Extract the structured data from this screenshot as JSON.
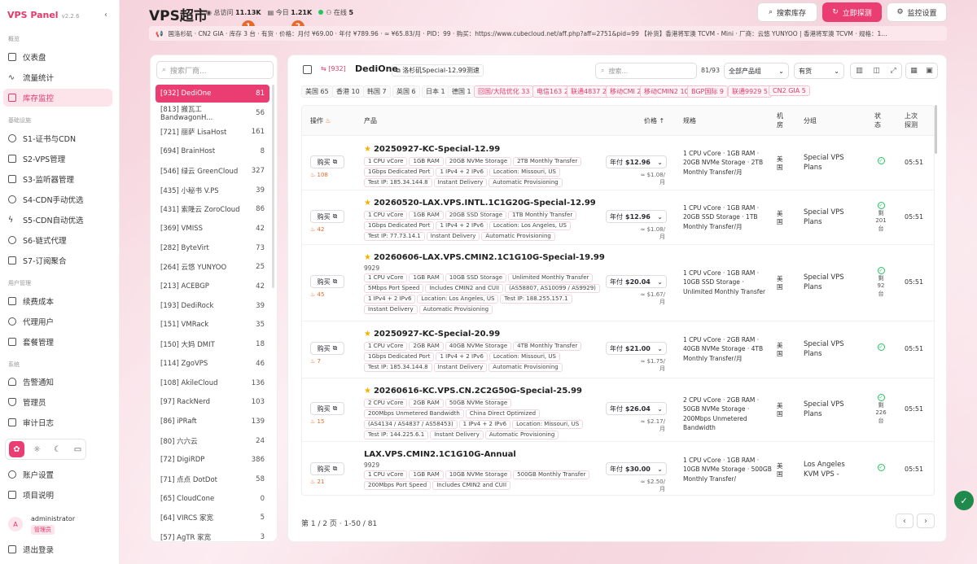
{
  "brand": {
    "name": "VPS Panel",
    "version": "v2.2.6"
  },
  "sidebar": {
    "section_overview": "概览",
    "section_infra": "基础设施",
    "section_user": "用户管理",
    "section_system": "系统",
    "items": [
      "仪表盘",
      "流量统计",
      "库存监控",
      "S1-证书与CDN",
      "S2-VPS管理",
      "S3-监听器管理",
      "S4-CDN手动优选",
      "S5-CDN自动优选",
      "S6-链式代理",
      "S7-订阅聚合",
      "续费成本",
      "代理用户",
      "套餐管理",
      "告警通知",
      "管理员",
      "审计日志",
      "账户设置",
      "项目说明",
      "退出登录"
    ],
    "user": {
      "avatar": "A",
      "name": "administrator",
      "role": "管理员"
    }
  },
  "header": {
    "title": "VPS超市",
    "visits_label": "总访问",
    "visits": "11.13K",
    "today_label": "今日",
    "today": "1.21K",
    "online_label": "在线",
    "online": "5",
    "badge1": "1",
    "badge2": "2",
    "search_btn": "搜索库存",
    "probe_btn": "立即探测",
    "settings_btn": "监控设置",
    "ticker": "国洛杉矶 · CN2 GIA · 库存 3 台 · 有货 · 价格：月付 ¥69.00 · 年付 ¥789.96 · ≈ ¥65.83/月 · PID：99 · 购买：https://www.cubecloud.net/aff.php?aff=2751&pid=99      【补货】香港将军澳 TCVM - Mini · 厂商：云悠 YUNYOO | 香港将军澳 TCVM · 规格：1… "
  },
  "providers": {
    "search_placeholder": "搜索厂商...",
    "items": [
      {
        "label": "[932] DediOne",
        "count": "81"
      },
      {
        "label": "[813] 搬瓦工 BandwagonH...",
        "count": "56"
      },
      {
        "label": "[721] 丽萨 LisaHost",
        "count": "161"
      },
      {
        "label": "[694] BrainHost",
        "count": "8"
      },
      {
        "label": "[546] 绿云 GreenCloud",
        "count": "327"
      },
      {
        "label": "[435] 小秘书 V.PS",
        "count": "39"
      },
      {
        "label": "[431] 索隆云 ZoroCloud",
        "count": "86"
      },
      {
        "label": "[369] VMISS",
        "count": "42"
      },
      {
        "label": "[282] ByteVirt",
        "count": "73"
      },
      {
        "label": "[264] 云悠 YUNYOO",
        "count": "25"
      },
      {
        "label": "[213] ACEBGP",
        "count": "42"
      },
      {
        "label": "[193] DediRock",
        "count": "39"
      },
      {
        "label": "[151] VMRack",
        "count": "35"
      },
      {
        "label": "[150] 大妈 DMIT",
        "count": "18"
      },
      {
        "label": "[114] ZgoVPS",
        "count": "46"
      },
      {
        "label": "[108] AkileCloud",
        "count": "136"
      },
      {
        "label": "[97] RackNerd",
        "count": "103"
      },
      {
        "label": "[86] iPRaft",
        "count": "139"
      },
      {
        "label": "[80] 六六云",
        "count": "24"
      },
      {
        "label": "[72] DigiRDP",
        "count": "386"
      },
      {
        "label": "[71] 点点 DotDot",
        "count": "58"
      },
      {
        "label": "[65] CloudCone",
        "count": "0"
      },
      {
        "label": "[64] VIRCS 家宽",
        "count": "5"
      },
      {
        "label": "[57] AgTR 家宽",
        "count": "3"
      }
    ]
  },
  "main": {
    "provider_tag": "[932]",
    "provider_name": "DediOne",
    "vendor_link": "洛杉矶Special-12.99测速",
    "search_placeholder": "搜索...",
    "count": "81/93",
    "group_select": "全部产品组",
    "stock_select": "有货",
    "chips": [
      {
        "label": "美国",
        "n": "65"
      },
      {
        "label": "香港",
        "n": "10"
      },
      {
        "label": "韩国",
        "n": "7"
      },
      {
        "label": "英国",
        "n": "6"
      },
      {
        "label": "日本",
        "n": "1"
      },
      {
        "label": "德国",
        "n": "1"
      },
      {
        "label": "回国/大陆优化",
        "n": "33"
      },
      {
        "label": "电信163",
        "n": "22"
      },
      {
        "label": "联通4837",
        "n": "22"
      },
      {
        "label": "移动CMI",
        "n": "22"
      },
      {
        "label": "移动CMIN2",
        "n": "10"
      },
      {
        "label": "BGP国际",
        "n": "9"
      },
      {
        "label": "联通9929",
        "n": "5"
      },
      {
        "label": "CN2 GIA",
        "n": "5"
      }
    ],
    "columns": {
      "op": "操作",
      "product": "产品",
      "price": "价格",
      "spec": "规格",
      "dc": "机房",
      "group": "分组",
      "status": "状态",
      "last": "上次探测"
    },
    "buy_label": "购买",
    "rows": [
      {
        "name": "20250927-KC-Special-12.99",
        "star": true,
        "sub": "",
        "tags": [
          "1 CPU vCore",
          "1GB RAM",
          "20GB NVMe Storage",
          "2TB Monthly Transfer",
          "1Gbps Dedicated Port",
          "1 IPv4 + 2 IPv6",
          "Location: Missouri, US",
          "Test IP: 185.34.144.8",
          "Instant Delivery",
          "Automatic Provisioning"
        ],
        "score": "108",
        "price": "$12.96",
        "per": "≈ $1.08/月",
        "spec": "1 CPU vCore · 1GB RAM · 20GB NVMe Storage · 2TB Monthly Transfer/月",
        "dc": "美国",
        "group": "Special VPS Plans",
        "stock": "",
        "time": "05:51"
      },
      {
        "name": "20260520-LAX.VPS.INTL.1C1G20G-Special-12.99",
        "star": true,
        "sub": "",
        "tags": [
          "1 CPU vCore",
          "1GB RAM",
          "20GB SSD Storage",
          "1TB Monthly Transfer",
          "1Gbps Dedicated Port",
          "1 IPv4 + 2 IPv6",
          "Location: Los Angeles, US",
          "Test IP: 77.73.14.1",
          "Instant Delivery",
          "Automatic Provisioning"
        ],
        "score": "42",
        "price": "$12.96",
        "per": "≈ $1.08/月",
        "spec": "1 CPU vCore · 1GB RAM · 20GB SSD Storage · 1TB Monthly Transfer/月",
        "dc": "美国",
        "group": "Special VPS Plans",
        "stock": "剩 201 台",
        "time": "05:51"
      },
      {
        "name": "20260606-LAX.VPS.CMIN2.1C1G10G-Special-19.99",
        "star": true,
        "sub": "9929",
        "tags": [
          "1 CPU vCore",
          "1GB RAM",
          "10GB SSD Storage",
          "Unlimited Monthly Transfer",
          "5Mbps Port Speed",
          "Includes CMIN2 and CUII",
          "(AS58807, AS10099 / AS9929)",
          "1 IPv4 + 2 IPv6",
          "Location: Los Angeles, US",
          "Test IP: 188.255.157.1",
          "Instant Delivery",
          "Automatic Provisioning"
        ],
        "score": "45",
        "price": "$20.04",
        "per": "≈ $1.67/月",
        "spec": "1 CPU vCore · 1GB RAM · 10GB SSD Storage · Unlimited Monthly Transfer",
        "dc": "美国",
        "group": "Special VPS Plans",
        "stock": "剩 92 台",
        "time": "05:51"
      },
      {
        "name": "20250927-KC-Special-20.99",
        "star": true,
        "sub": "",
        "tags": [
          "1 CPU vCore",
          "2GB RAM",
          "40GB NVMe Storage",
          "4TB Monthly Transfer",
          "1Gbps Dedicated Port",
          "1 IPv4 + 2 IPv6",
          "Location: Missouri, US",
          "Test IP: 185.34.144.8",
          "Instant Delivery",
          "Automatic Provisioning"
        ],
        "score": "7",
        "price": "$21.00",
        "per": "≈ $1.75/月",
        "spec": "1 CPU vCore · 2GB RAM · 40GB NVMe Storage · 4TB Monthly Transfer/月",
        "dc": "美国",
        "group": "Special VPS Plans",
        "stock": "",
        "time": "05:51"
      },
      {
        "name": "20260616-KC.VPS.CN.2C2G50G-Special-25.99",
        "star": true,
        "sub": "",
        "tags": [
          "2 CPU vCore",
          "2GB RAM",
          "50GB NVMe Storage",
          "200Mbps Unmetered Bandwidth",
          "China Direct Optimized",
          "(AS4134 / AS4837 / AS58453)",
          "1 IPv4 + 2 IPv6",
          "Location: Missouri, US",
          "Test IP: 144.225.6.1",
          "Instant Delivery",
          "Automatic Provisioning"
        ],
        "score": "15",
        "price": "$26.04",
        "per": "≈ $2.17/月",
        "spec": "2 CPU vCore · 2GB RAM · 50GB NVMe Storage · 200Mbps Unmetered Bandwidth",
        "dc": "美国",
        "group": "Special VPS Plans",
        "stock": "剩 226 台",
        "time": "05:51"
      },
      {
        "name": "LAX.VPS.CMIN2.1C1G10G-Annual",
        "star": false,
        "sub": "9929",
        "tags": [
          "1 CPU vCore",
          "1GB RAM",
          "10GB NVMe Storage",
          "500GB Monthly Transfer",
          "200Mbps Port Speed",
          "Includes CMIN2 and CUII"
        ],
        "score": "21",
        "price": "$30.00",
        "per": "≈ $2.50/月",
        "spec": "1 CPU vCore · 1GB RAM · 10GB NVMe Storage · 500GB Monthly Transfer/",
        "dc": "美国",
        "group": "Los Angeles KVM VPS -",
        "stock": "",
        "time": "05:51"
      }
    ],
    "cycle": "年付",
    "pager": "第 1 / 2 页 · 1-50 / 81"
  }
}
